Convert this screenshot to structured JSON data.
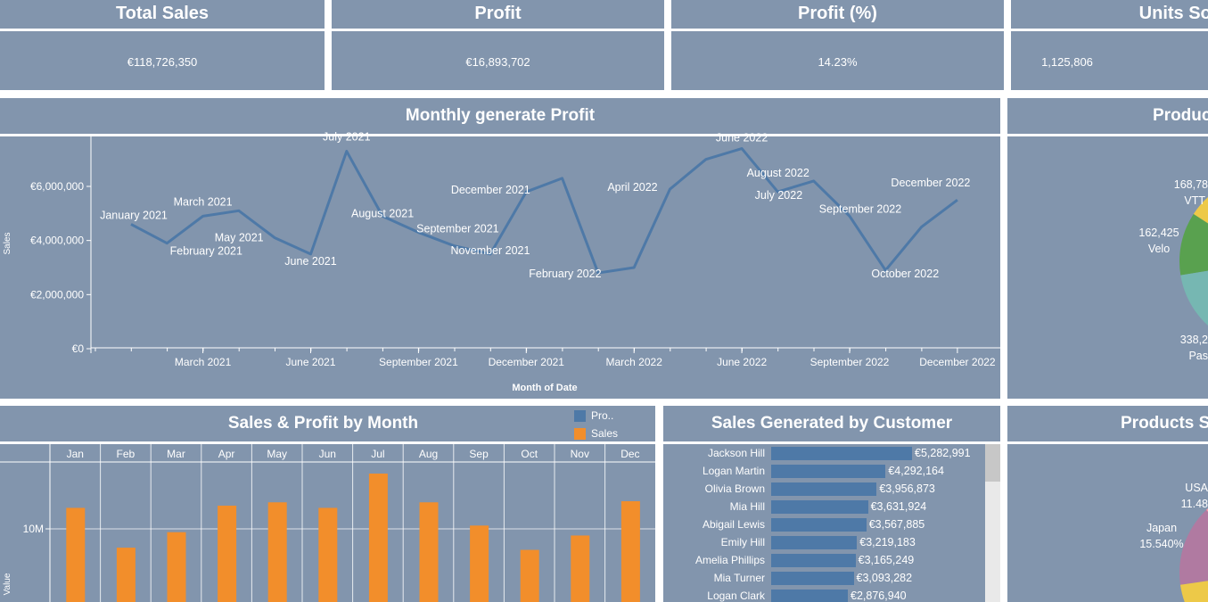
{
  "kpis": [
    {
      "title": "Total Sales",
      "value": "€118,726,350"
    },
    {
      "title": "Profit",
      "value": "€16,893,702"
    },
    {
      "title": "Profit (%)",
      "value": "14.23%"
    },
    {
      "title": "Units Sol",
      "value": "1,125,806"
    }
  ],
  "monthly_panel": {
    "title": "Monthly generate Profit"
  },
  "product_panel": {
    "title": "Produc"
  },
  "sales_profit_panel": {
    "title": "Sales & Profit by Month"
  },
  "customer_panel": {
    "title": "Sales Generated by Customer"
  },
  "products_country_panel": {
    "title": "Products S"
  },
  "colors": {
    "panel_bg": "#8295ad",
    "line": "#4e79a7",
    "profit_swatch": "#4e79a7",
    "sales_bar": "#f28e2b"
  },
  "chart_data": [
    {
      "type": "line",
      "title": "Monthly generate Profit",
      "xlabel": "Month of Date",
      "ylabel": "Sales",
      "x": [
        "January 2021",
        "February 2021",
        "March 2021",
        "April 2021",
        "May 2021",
        "June 2021",
        "July 2021",
        "August 2021",
        "September 2021",
        "October 2021",
        "November 2021",
        "December 2021",
        "January 2022",
        "February 2022",
        "March 2022",
        "April 2022",
        "May 2022",
        "June 2022",
        "July 2022",
        "August 2022",
        "September 2022",
        "October 2022",
        "November 2022",
        "December 2022"
      ],
      "values": [
        4600000,
        3900000,
        4900000,
        5100000,
        4100000,
        3500000,
        7300000,
        4900000,
        4300000,
        3800000,
        3500000,
        5800000,
        6300000,
        2800000,
        3000000,
        5900000,
        7000000,
        7400000,
        5800000,
        6200000,
        4900000,
        2900000,
        4500000,
        5500000
      ],
      "point_labels": {
        "January 2021": "January 2021",
        "February 2021": "February 2021",
        "March 2021": "March 2021",
        "May 2021": "May 2021",
        "June 2021": "June 2021",
        "July 2021": "July 2021",
        "August 2021": "August 2021",
        "September 2021": "September 2021",
        "November 2021": "November 2021",
        "December 2021": "December 2021",
        "February 2022": "February 2022",
        "April 2022": "April 2022",
        "June 2022": "June 2022",
        "July 2022": "July 2022",
        "August 2022": "August 2022",
        "September 2022": "September 2022",
        "October 2022": "October 2022",
        "December 2022": "December 2022"
      },
      "x_ticks": [
        "March 2021",
        "June 2021",
        "September 2021",
        "December 2021",
        "March 2022",
        "June 2022",
        "September 2022",
        "December 2022"
      ],
      "y_ticks": [
        {
          "value": 0,
          "label": "€0"
        },
        {
          "value": 2000000,
          "label": "€2,000,000"
        },
        {
          "value": 4000000,
          "label": "€4,000,000"
        },
        {
          "value": 6000000,
          "label": "€6,000,000"
        }
      ],
      "ylim": [
        0,
        7900000
      ]
    },
    {
      "type": "bar",
      "title": "Sales & Profit by Month",
      "categories": [
        "Jan",
        "Feb",
        "Mar",
        "Apr",
        "May",
        "Jun",
        "Jul",
        "Aug",
        "Sep",
        "Oct",
        "Nov",
        "Dec"
      ],
      "series": [
        {
          "name": "Pro..",
          "values": []
        },
        {
          "name": "Sales",
          "values": [
            11900000,
            8300000,
            9700000,
            12100000,
            12400000,
            11900000,
            15000000,
            12400000,
            10300000,
            8100000,
            9400000,
            12500000
          ]
        }
      ],
      "ylabel": "Value",
      "y_ticks": [
        {
          "value": 10000000,
          "label": "10M"
        }
      ],
      "ylim_visible": [
        6600000,
        16600000
      ]
    },
    {
      "type": "bar",
      "title": "Sales Generated by Customer",
      "categories": [
        "Jackson Hill",
        "Logan Martin",
        "Olivia Brown",
        "Mia Hill",
        "Abigail Lewis",
        "Emily Hill",
        "Amelia Phillips",
        "Mia Turner",
        "Logan Clark"
      ],
      "values": [
        5282991,
        4292164,
        3956873,
        3631924,
        3567885,
        3219183,
        3165249,
        3093282,
        2876940
      ],
      "value_labels": [
        "€5,282,991",
        "€4,292,164",
        "€3,956,873",
        "€3,631,924",
        "€3,567,885",
        "€3,219,183",
        "€3,165,249",
        "€3,093,282",
        "€2,876,940"
      ]
    },
    {
      "type": "pie",
      "title": "Produc",
      "labels": [
        {
          "value": "168,78",
          "name": "VTT"
        },
        {
          "value": "162,425",
          "name": "Velo"
        },
        {
          "value": "338,2",
          "name": "Pas"
        }
      ]
    },
    {
      "type": "pie",
      "title": "Products S",
      "labels": [
        {
          "name": "USA",
          "value": "11.48"
        },
        {
          "name": "Japan",
          "value": "15.540%"
        }
      ]
    }
  ]
}
